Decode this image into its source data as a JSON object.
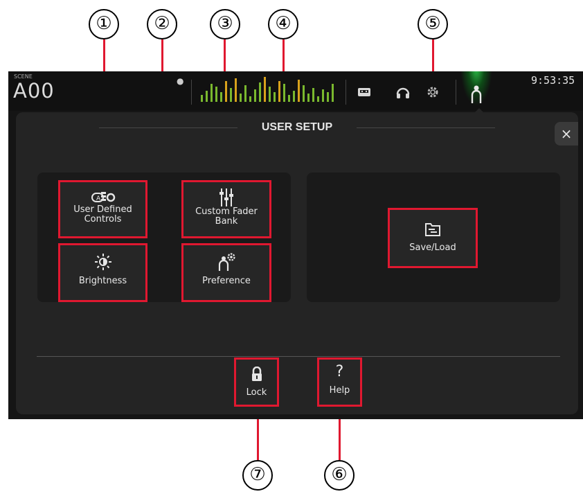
{
  "callouts": [
    "①",
    "②",
    "③",
    "④",
    "⑤",
    "⑦",
    "⑥"
  ],
  "topbar": {
    "scene_label": "SCENE",
    "scene_name": "A00",
    "clock": "9:53:35"
  },
  "panel": {
    "title": "USER SETUP",
    "close_label": "×",
    "buttons": {
      "user_defined_controls": "User Defined\nControls",
      "brightness": "Brightness",
      "custom_fader_bank": "Custom Fader\nBank",
      "preference": "Preference",
      "save_load": "Save/Load",
      "lock": "Lock",
      "help": "Help"
    },
    "help_glyph": "?"
  },
  "colors": {
    "highlight": "#e01830",
    "active_user_tab": "#2ec24a"
  },
  "icons": [
    "info-icon",
    "level-meter-icon",
    "recorder-icon",
    "headphones-icon",
    "gear-icon",
    "user-icon",
    "user-defined-controls-icon",
    "brightness-icon",
    "fader-icon",
    "preference-icon",
    "save-load-icon",
    "lock-icon",
    "help-icon"
  ]
}
